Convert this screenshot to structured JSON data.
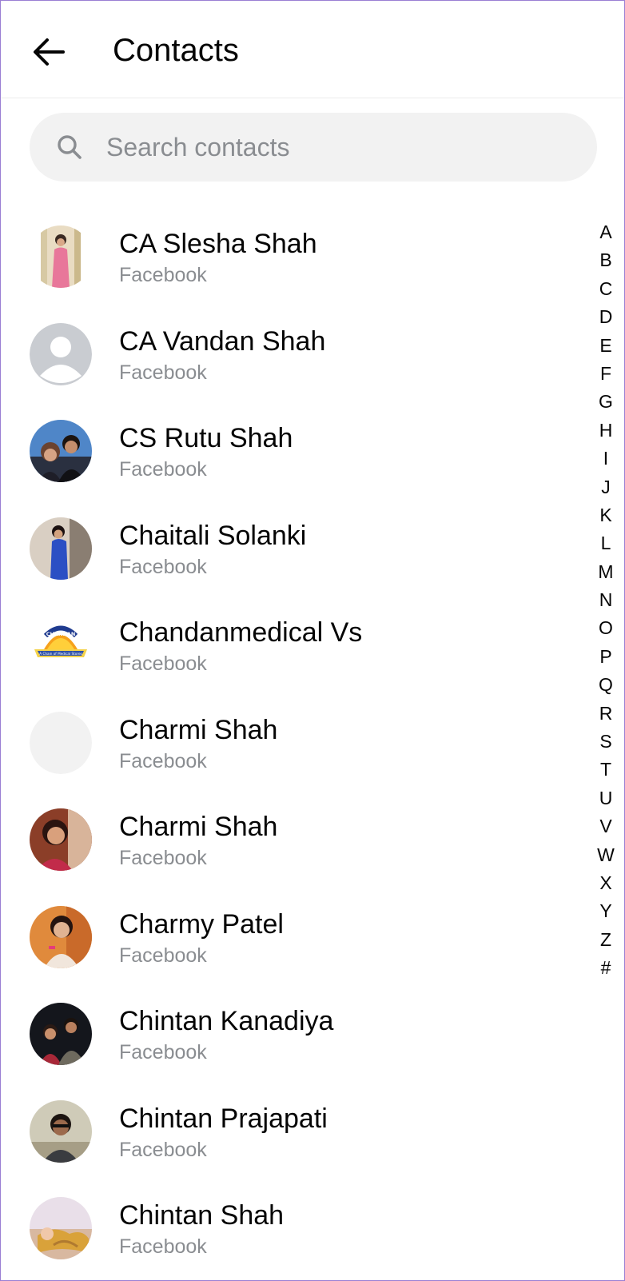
{
  "header": {
    "title": "Contacts"
  },
  "search": {
    "placeholder": "Search contacts",
    "value": ""
  },
  "contacts": [
    {
      "name": "CA Slesha Shah",
      "source": "Facebook"
    },
    {
      "name": "CA Vandan Shah",
      "source": "Facebook"
    },
    {
      "name": "CS Rutu Shah",
      "source": "Facebook"
    },
    {
      "name": "Chaitali Solanki",
      "source": "Facebook"
    },
    {
      "name": "Chandanmedical Vs",
      "source": "Facebook"
    },
    {
      "name": "Charmi Shah",
      "source": "Facebook"
    },
    {
      "name": "Charmi Shah",
      "source": "Facebook"
    },
    {
      "name": "Charmy Patel",
      "source": "Facebook"
    },
    {
      "name": "Chintan Kanadiya",
      "source": "Facebook"
    },
    {
      "name": "Chintan Prajapati",
      "source": "Facebook"
    },
    {
      "name": "Chintan Shah",
      "source": "Facebook"
    }
  ],
  "alphabet_index": [
    "A",
    "B",
    "C",
    "D",
    "E",
    "F",
    "G",
    "H",
    "I",
    "J",
    "K",
    "L",
    "M",
    "N",
    "O",
    "P",
    "Q",
    "R",
    "S",
    "T",
    "U",
    "V",
    "W",
    "X",
    "Y",
    "Z",
    "#"
  ],
  "logo_text": {
    "chandan_top": "CHANDAN",
    "chandan_ribbon": "A Chain of Medical Stores"
  },
  "colors": {
    "text_primary": "#050505",
    "text_secondary": "#8a8d91",
    "search_bg": "#f2f2f2",
    "divider": "#ececec",
    "default_avatar_bg": "#c9ccd1",
    "frame_border": "#9a7fd3"
  }
}
